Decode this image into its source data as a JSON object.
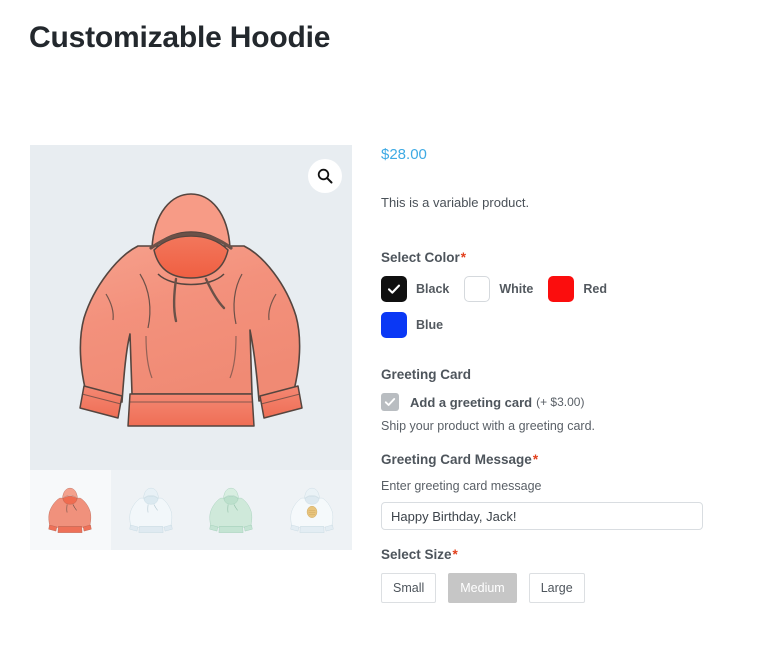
{
  "page": {
    "title": "Customizable Hoodie"
  },
  "gallery": {
    "zoom_icon": "search-icon",
    "main_image_alt": "Coral watercolor hoodie",
    "thumbnails": [
      {
        "name": "hoodie-coral",
        "color": "#ef8873",
        "active": true
      },
      {
        "name": "hoodie-white-blue",
        "color": "#dbe7ee",
        "active": false
      },
      {
        "name": "hoodie-mint",
        "color": "#bfe3d3",
        "active": false
      },
      {
        "name": "hoodie-white-emblem",
        "color": "#e4ecf1",
        "active": false
      }
    ]
  },
  "summary": {
    "price": "$28.00",
    "short_description": "This is a variable product."
  },
  "color_field": {
    "label": "Select Color",
    "required_mark": "*",
    "options": [
      {
        "label": "Black",
        "hex": "#101010",
        "selected": true,
        "outlined": false
      },
      {
        "label": "White",
        "hex": "#ffffff",
        "selected": false,
        "outlined": true
      },
      {
        "label": "Red",
        "hex": "#fb0d0d",
        "selected": false,
        "outlined": false
      },
      {
        "label": "Blue",
        "hex": "#0a38f5",
        "selected": false,
        "outlined": false
      }
    ]
  },
  "greeting_card": {
    "label": "Greeting Card",
    "checkbox_label": "Add a greeting card",
    "checkbox_price": "(+ $3.00)",
    "checked": true,
    "help_text": "Ship your product with a greeting card."
  },
  "greeting_message": {
    "label": "Greeting Card Message",
    "required_mark": "*",
    "sub_label": "Enter greeting card message",
    "value": "Happy Birthday, Jack!",
    "placeholder": "Enter greeting card message"
  },
  "size_field": {
    "label": "Select Size",
    "required_mark": "*",
    "options": [
      {
        "label": "Small",
        "selected": false
      },
      {
        "label": "Medium",
        "selected": true
      },
      {
        "label": "Large",
        "selected": false
      }
    ]
  },
  "colors": {
    "accent": "#3eaae4",
    "required": "#e2401c",
    "image_bg": "#e8edf1",
    "thumb_bg": "#eef2f5",
    "selected_size_bg": "#c6c6c6"
  }
}
